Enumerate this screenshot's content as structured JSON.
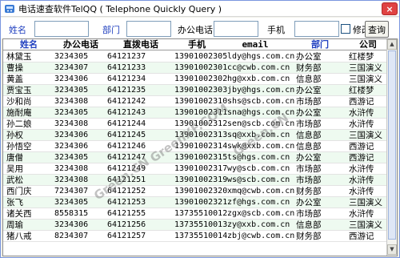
{
  "window": {
    "title": "电话速查软件TelQQ ( Telephone Quickly Query )",
    "close_label": "×"
  },
  "search": {
    "name_label": "姓名",
    "name_value": "",
    "dept_label": "部门",
    "dept_value": "",
    "office_label": "办公电话",
    "office_value": "",
    "mobile_label": "手机",
    "mobile_value": "",
    "modify_label": "修改",
    "modify_checked": false,
    "query_button": "查询"
  },
  "table": {
    "headers": [
      "姓名",
      "办公电话",
      "直拨电话",
      "手机",
      "email",
      "部门",
      "公司"
    ],
    "rows": [
      [
        "林黛玉",
        "3234305",
        "64121237",
        "13901002305",
        "ldy@hgs.com.cn",
        "办公室",
        "红楼梦"
      ],
      [
        "曹操",
        "3234307",
        "64121233",
        "13901002301",
        "cc@cwb.com.cn",
        "财务部",
        "三国演义"
      ],
      [
        "黄盖",
        "3234306",
        "64121234",
        "13901002302",
        "hg@xxb.com.cn",
        "信息部",
        "三国演义"
      ],
      [
        "贾宝玉",
        "3234305",
        "64121235",
        "13901002303",
        "jby@hgs.com.cn",
        "办公室",
        "红楼梦"
      ],
      [
        "沙和尚",
        "3234308",
        "64121242",
        "13901002310",
        "shs@scb.com.cn",
        "市场部",
        "西游记"
      ],
      [
        "施耐庵",
        "3234305",
        "64121243",
        "13901002311",
        "sna@hgs.com.cn",
        "办公室",
        "水浒传"
      ],
      [
        "孙二娘",
        "3234308",
        "64121244",
        "13901002312",
        "sen@scb.com.cn",
        "市场部",
        "水浒传"
      ],
      [
        "孙权",
        "3234306",
        "64121245",
        "13901002313",
        "sq@xxb.com.cn",
        "信息部",
        "三国演义"
      ],
      [
        "孙悟空",
        "3234306",
        "64121246",
        "13901002314",
        "swk@xxb.com.cn",
        "信息部",
        "西游记"
      ],
      [
        "唐僧",
        "3234305",
        "64121247",
        "13901002315",
        "ts@hgs.com.cn",
        "办公室",
        "西游记"
      ],
      [
        "吴用",
        "3234308",
        "64121249",
        "13901002317",
        "wy@scb.com.cn",
        "市场部",
        "水浒传"
      ],
      [
        "武松",
        "3234308",
        "64121251",
        "13901002319",
        "ws@scb.com.cn",
        "市场部",
        "水浒传"
      ],
      [
        "西门庆",
        "7234307",
        "64121252",
        "13901002320",
        "xmq@cwb.com.cn",
        "财务部",
        "水浒传"
      ],
      [
        "张飞",
        "3234305",
        "64121253",
        "13901002321",
        "zf@hgs.com.cn",
        "办公室",
        "三国演义"
      ],
      [
        "诸关西",
        "8558315",
        "64121255",
        "13735510012",
        "zgx@scb.com.cn",
        "市场部",
        "水浒传"
      ],
      [
        "周瑜",
        "3234306",
        "64121256",
        "13735510013",
        "zy@xxb.com.cn",
        "信息部",
        "三国演义"
      ],
      [
        "猪八戒",
        "8234307",
        "64121257",
        "13735510014",
        "zbj@cwb.com.cn",
        "财务部",
        "西游记"
      ]
    ]
  },
  "watermarks": [
    "Green.CN",
    "GreenXF.COM",
    "Green.CN"
  ],
  "colors": {
    "label_blue": "#1f3fbf",
    "alt_row": "#eefaf0",
    "close_red": "#e04343"
  }
}
